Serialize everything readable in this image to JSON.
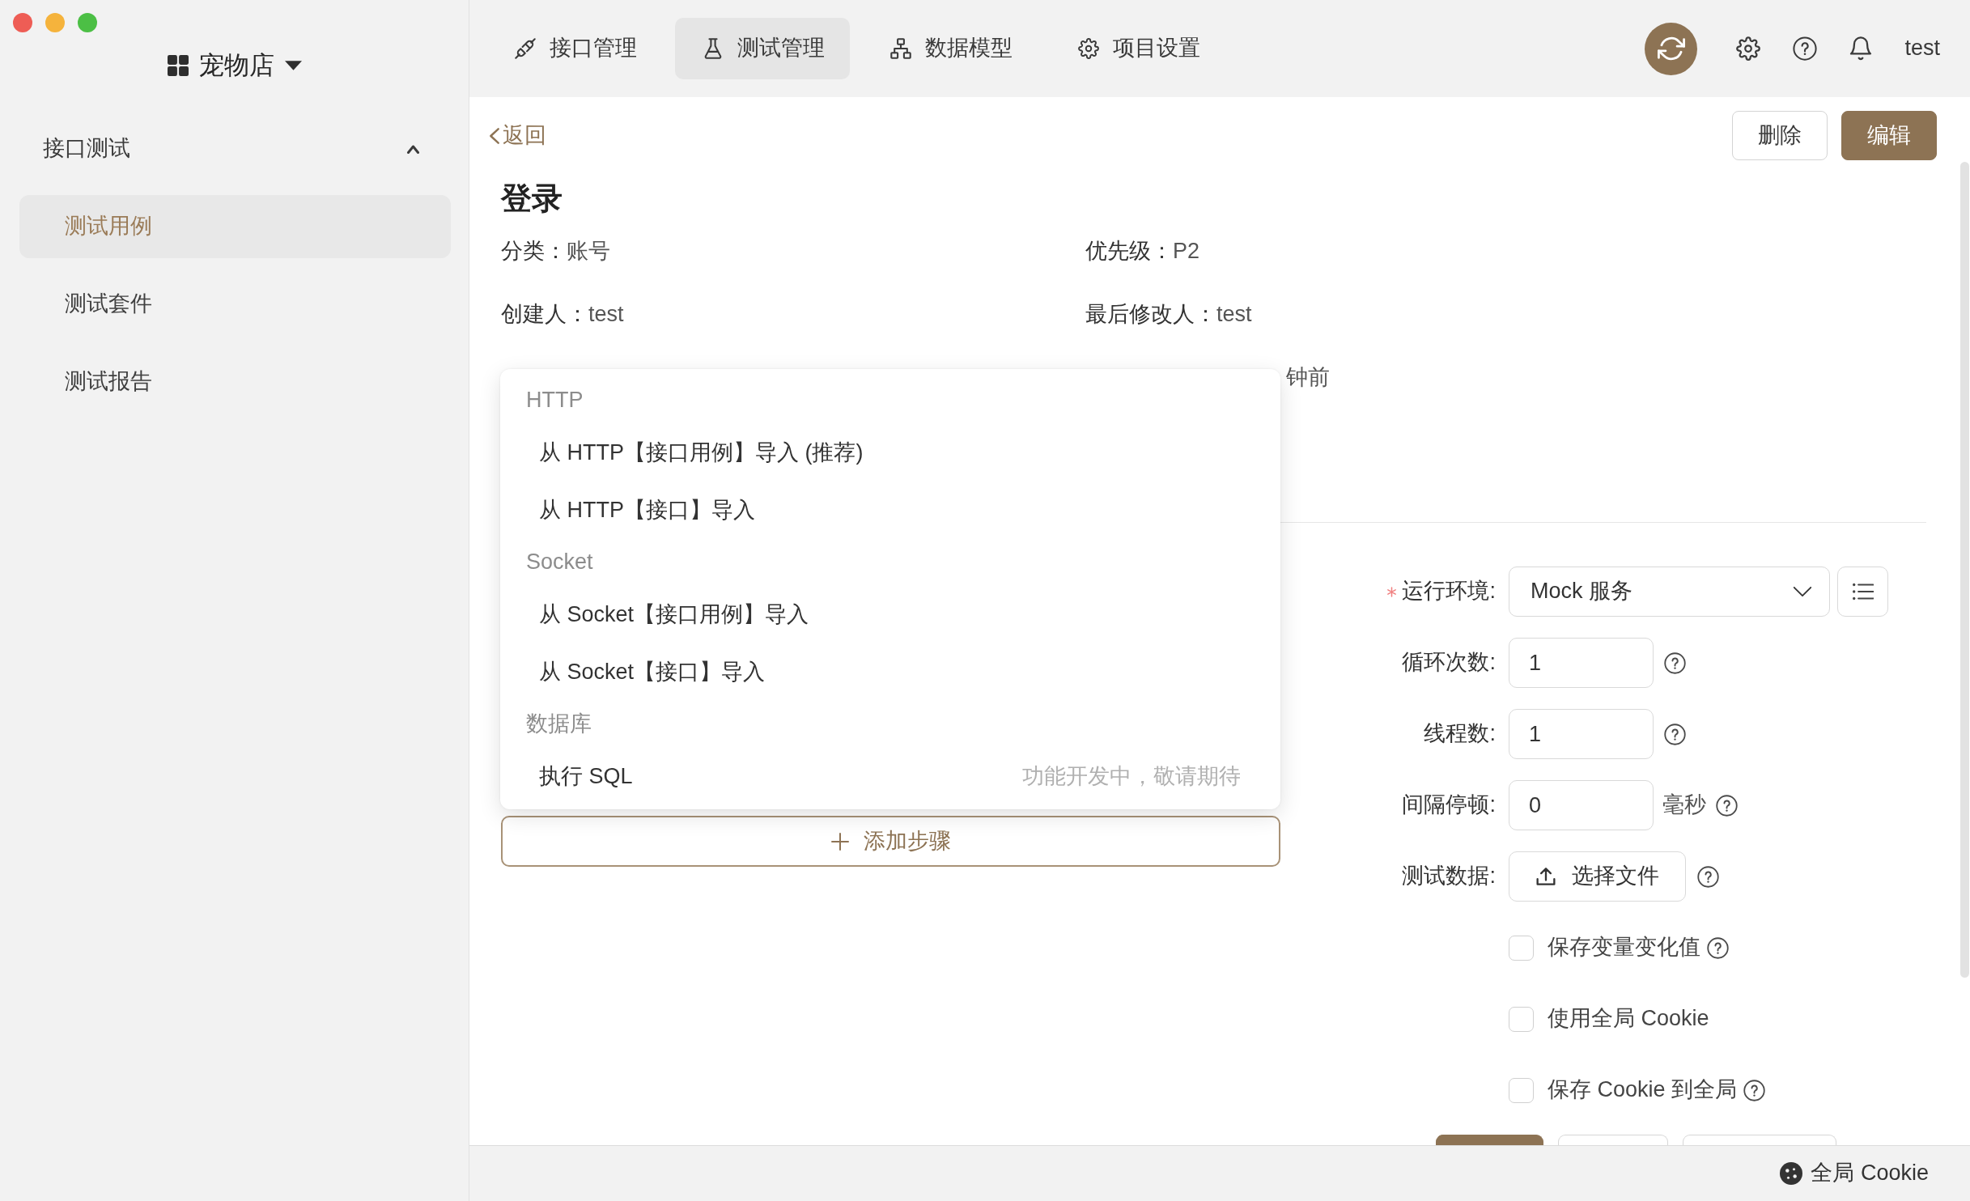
{
  "sidebar": {
    "project": "宠物店",
    "group": {
      "label": "接口测试",
      "expanded": true
    },
    "items": [
      {
        "label": "测试用例",
        "selected": true
      },
      {
        "label": "测试套件",
        "selected": false
      },
      {
        "label": "测试报告",
        "selected": false
      }
    ]
  },
  "topbar": {
    "tabs": [
      {
        "label": "接口管理",
        "selected": false
      },
      {
        "label": "测试管理",
        "selected": true
      },
      {
        "label": "数据模型",
        "selected": false
      },
      {
        "label": "项目设置",
        "selected": false
      }
    ],
    "user": "test"
  },
  "detail": {
    "back": "返回",
    "buttons": [
      {
        "label": "删除",
        "kind": "outline"
      },
      {
        "label": "编辑",
        "kind": "primary"
      }
    ],
    "title": "登录",
    "info": [
      {
        "label": "分类：",
        "value": "账号"
      },
      {
        "label": "优先级：",
        "value": "P2"
      },
      {
        "label": "创建人：",
        "value": "test"
      },
      {
        "label": "最后修改人：",
        "value": "test"
      }
    ],
    "info_fragment": "钟前"
  },
  "steps": {
    "add_button": "添加步骤",
    "menu": [
      {
        "header": "HTTP",
        "items": [
          {
            "label": "从 HTTP【接口用例】导入 (推荐)"
          },
          {
            "label": "从 HTTP【接口】导入"
          }
        ]
      },
      {
        "header": "Socket",
        "items": [
          {
            "label": "从 Socket【接口用例】导入"
          },
          {
            "label": "从 Socket【接口】导入"
          }
        ]
      },
      {
        "header": "数据库",
        "items": [
          {
            "label": "执行 SQL",
            "note": "功能开发中，敬请期待"
          }
        ]
      }
    ]
  },
  "run_form": {
    "fields": [
      {
        "kind": "select",
        "label": "运行环境:",
        "required": true,
        "value": "Mock 服务",
        "help": false
      },
      {
        "kind": "number",
        "label": "循环次数:",
        "required": false,
        "value": "1",
        "help": true
      },
      {
        "kind": "number",
        "label": "线程数:",
        "required": false,
        "value": "1",
        "help": true
      },
      {
        "kind": "number",
        "label": "间隔停顿:",
        "required": false,
        "value": "0",
        "unit": "毫秒",
        "help": true
      },
      {
        "kind": "upload",
        "label": "测试数据:",
        "required": false,
        "button": "选择文件",
        "help": true
      },
      {
        "kind": "checkbox",
        "label": "保存变量变化值",
        "checked": false,
        "help": true
      },
      {
        "kind": "checkbox",
        "label": "使用全局 Cookie",
        "checked": false,
        "help": false
      },
      {
        "kind": "checkbox",
        "label": "保存 Cookie 到全局",
        "checked": false,
        "help": true
      }
    ],
    "actions": [
      {
        "kind": "primary"
      },
      {
        "kind": "outline"
      },
      {
        "kind": "outline"
      }
    ]
  },
  "status_bar": {
    "cookie": "全局 Cookie"
  }
}
